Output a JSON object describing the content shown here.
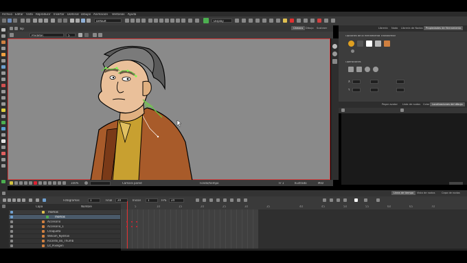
{
  "menu": [
    "Archivo",
    "Editar",
    "Vista",
    "Reproducir",
    "Insertar",
    "Dominar",
    "Dibujar",
    "Animación",
    "Ventanas",
    "Ayuda"
  ],
  "toolbar": {
    "default_label": "Default",
    "display_label": "Display"
  },
  "tool_props": {
    "preset_label": "Predeter.",
    "value": "5"
  },
  "view_tabs": [
    "Cámara",
    "Dibujo",
    "Sustraer"
  ],
  "panel_tabs": [
    "Librería",
    "Nodo",
    "Librería de Nodos",
    "Propiedades de Herramienta"
  ],
  "panel": {
    "section1": "Opciones de la Herramienta Transformar",
    "section2": "Operaciones",
    "lower_tabs": [
      "Pegar avatar",
      "Lista de nodos",
      "Color",
      "Localizaciones del dibujo"
    ]
  },
  "status": {
    "zoom": "100%",
    "shared": "Cámara pared",
    "center": "Fondo/tiempo",
    "frame": "Fr 1",
    "drawing": "Ilustrado",
    "mode": "Ms0"
  },
  "timeline": {
    "fields": {
      "frames_label": "Fotogramas",
      "frames": "1",
      "end_label": "Final",
      "end": "20",
      "fps_label": "FPS",
      "fps": "24",
      "start_label": "Iniciar",
      "start": "1"
    },
    "tabs": [
      "Línea de tiempo",
      "Vista de nodos",
      "Capa de nodos"
    ],
    "header": {
      "name": "Nombre"
    },
    "layers": [
      {
        "name": "Thomas",
        "type": "group"
      },
      {
        "name": "Thomas",
        "type": "child"
      },
      {
        "name": "Accesorio",
        "type": "drawing"
      },
      {
        "name": "Accesorio_1",
        "type": "drawing"
      },
      {
        "name": "Chaqueta",
        "type": "drawing"
      },
      {
        "name": "William_Nydrlan",
        "type": "drawing"
      },
      {
        "name": "Ricardo_Bo_Thumb",
        "type": "drawing"
      },
      {
        "name": "Lit_Pixelgen",
        "type": "drawing"
      }
    ],
    "ruler": [
      "5",
      "10",
      "15",
      "20",
      "25",
      "30",
      "35",
      "40",
      "45",
      "50",
      "55",
      "60",
      "65",
      "70"
    ]
  },
  "colors": {
    "accent_red": "#e03030",
    "bg_dark": "#1a1a1a",
    "canvas_gray": "#8a8a8a",
    "timeline_red": "#d02020"
  }
}
